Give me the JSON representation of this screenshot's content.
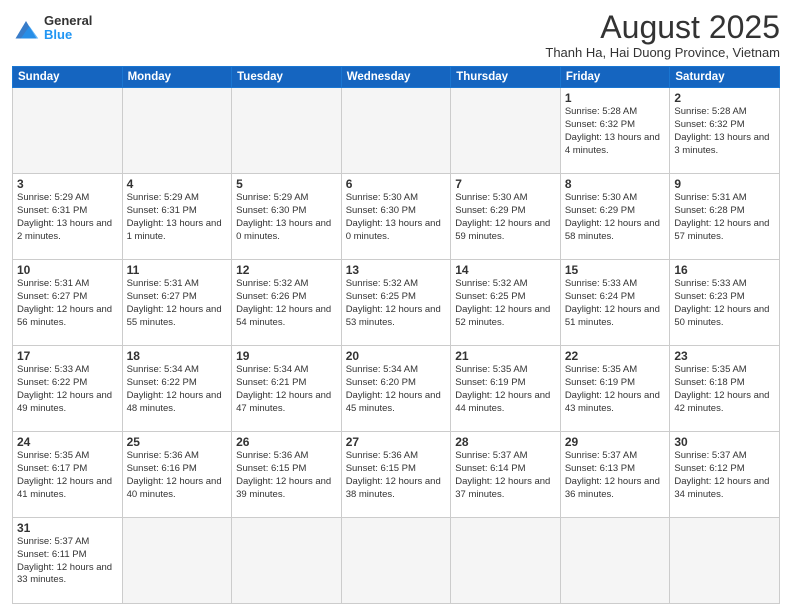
{
  "header": {
    "logo_general": "General",
    "logo_blue": "Blue",
    "month_title": "August 2025",
    "subtitle": "Thanh Ha, Hai Duong Province, Vietnam"
  },
  "weekdays": [
    "Sunday",
    "Monday",
    "Tuesday",
    "Wednesday",
    "Thursday",
    "Friday",
    "Saturday"
  ],
  "weeks": [
    [
      {
        "day": "",
        "info": ""
      },
      {
        "day": "",
        "info": ""
      },
      {
        "day": "",
        "info": ""
      },
      {
        "day": "",
        "info": ""
      },
      {
        "day": "",
        "info": ""
      },
      {
        "day": "1",
        "info": "Sunrise: 5:28 AM\nSunset: 6:32 PM\nDaylight: 13 hours and 4 minutes."
      },
      {
        "day": "2",
        "info": "Sunrise: 5:28 AM\nSunset: 6:32 PM\nDaylight: 13 hours and 3 minutes."
      }
    ],
    [
      {
        "day": "3",
        "info": "Sunrise: 5:29 AM\nSunset: 6:31 PM\nDaylight: 13 hours and 2 minutes."
      },
      {
        "day": "4",
        "info": "Sunrise: 5:29 AM\nSunset: 6:31 PM\nDaylight: 13 hours and 1 minute."
      },
      {
        "day": "5",
        "info": "Sunrise: 5:29 AM\nSunset: 6:30 PM\nDaylight: 13 hours and 0 minutes."
      },
      {
        "day": "6",
        "info": "Sunrise: 5:30 AM\nSunset: 6:30 PM\nDaylight: 13 hours and 0 minutes."
      },
      {
        "day": "7",
        "info": "Sunrise: 5:30 AM\nSunset: 6:29 PM\nDaylight: 12 hours and 59 minutes."
      },
      {
        "day": "8",
        "info": "Sunrise: 5:30 AM\nSunset: 6:29 PM\nDaylight: 12 hours and 58 minutes."
      },
      {
        "day": "9",
        "info": "Sunrise: 5:31 AM\nSunset: 6:28 PM\nDaylight: 12 hours and 57 minutes."
      }
    ],
    [
      {
        "day": "10",
        "info": "Sunrise: 5:31 AM\nSunset: 6:27 PM\nDaylight: 12 hours and 56 minutes."
      },
      {
        "day": "11",
        "info": "Sunrise: 5:31 AM\nSunset: 6:27 PM\nDaylight: 12 hours and 55 minutes."
      },
      {
        "day": "12",
        "info": "Sunrise: 5:32 AM\nSunset: 6:26 PM\nDaylight: 12 hours and 54 minutes."
      },
      {
        "day": "13",
        "info": "Sunrise: 5:32 AM\nSunset: 6:25 PM\nDaylight: 12 hours and 53 minutes."
      },
      {
        "day": "14",
        "info": "Sunrise: 5:32 AM\nSunset: 6:25 PM\nDaylight: 12 hours and 52 minutes."
      },
      {
        "day": "15",
        "info": "Sunrise: 5:33 AM\nSunset: 6:24 PM\nDaylight: 12 hours and 51 minutes."
      },
      {
        "day": "16",
        "info": "Sunrise: 5:33 AM\nSunset: 6:23 PM\nDaylight: 12 hours and 50 minutes."
      }
    ],
    [
      {
        "day": "17",
        "info": "Sunrise: 5:33 AM\nSunset: 6:22 PM\nDaylight: 12 hours and 49 minutes."
      },
      {
        "day": "18",
        "info": "Sunrise: 5:34 AM\nSunset: 6:22 PM\nDaylight: 12 hours and 48 minutes."
      },
      {
        "day": "19",
        "info": "Sunrise: 5:34 AM\nSunset: 6:21 PM\nDaylight: 12 hours and 47 minutes."
      },
      {
        "day": "20",
        "info": "Sunrise: 5:34 AM\nSunset: 6:20 PM\nDaylight: 12 hours and 45 minutes."
      },
      {
        "day": "21",
        "info": "Sunrise: 5:35 AM\nSunset: 6:19 PM\nDaylight: 12 hours and 44 minutes."
      },
      {
        "day": "22",
        "info": "Sunrise: 5:35 AM\nSunset: 6:19 PM\nDaylight: 12 hours and 43 minutes."
      },
      {
        "day": "23",
        "info": "Sunrise: 5:35 AM\nSunset: 6:18 PM\nDaylight: 12 hours and 42 minutes."
      }
    ],
    [
      {
        "day": "24",
        "info": "Sunrise: 5:35 AM\nSunset: 6:17 PM\nDaylight: 12 hours and 41 minutes."
      },
      {
        "day": "25",
        "info": "Sunrise: 5:36 AM\nSunset: 6:16 PM\nDaylight: 12 hours and 40 minutes."
      },
      {
        "day": "26",
        "info": "Sunrise: 5:36 AM\nSunset: 6:15 PM\nDaylight: 12 hours and 39 minutes."
      },
      {
        "day": "27",
        "info": "Sunrise: 5:36 AM\nSunset: 6:15 PM\nDaylight: 12 hours and 38 minutes."
      },
      {
        "day": "28",
        "info": "Sunrise: 5:37 AM\nSunset: 6:14 PM\nDaylight: 12 hours and 37 minutes."
      },
      {
        "day": "29",
        "info": "Sunrise: 5:37 AM\nSunset: 6:13 PM\nDaylight: 12 hours and 36 minutes."
      },
      {
        "day": "30",
        "info": "Sunrise: 5:37 AM\nSunset: 6:12 PM\nDaylight: 12 hours and 34 minutes."
      }
    ],
    [
      {
        "day": "31",
        "info": "Sunrise: 5:37 AM\nSunset: 6:11 PM\nDaylight: 12 hours and 33 minutes."
      },
      {
        "day": "",
        "info": ""
      },
      {
        "day": "",
        "info": ""
      },
      {
        "day": "",
        "info": ""
      },
      {
        "day": "",
        "info": ""
      },
      {
        "day": "",
        "info": ""
      },
      {
        "day": "",
        "info": ""
      }
    ]
  ]
}
